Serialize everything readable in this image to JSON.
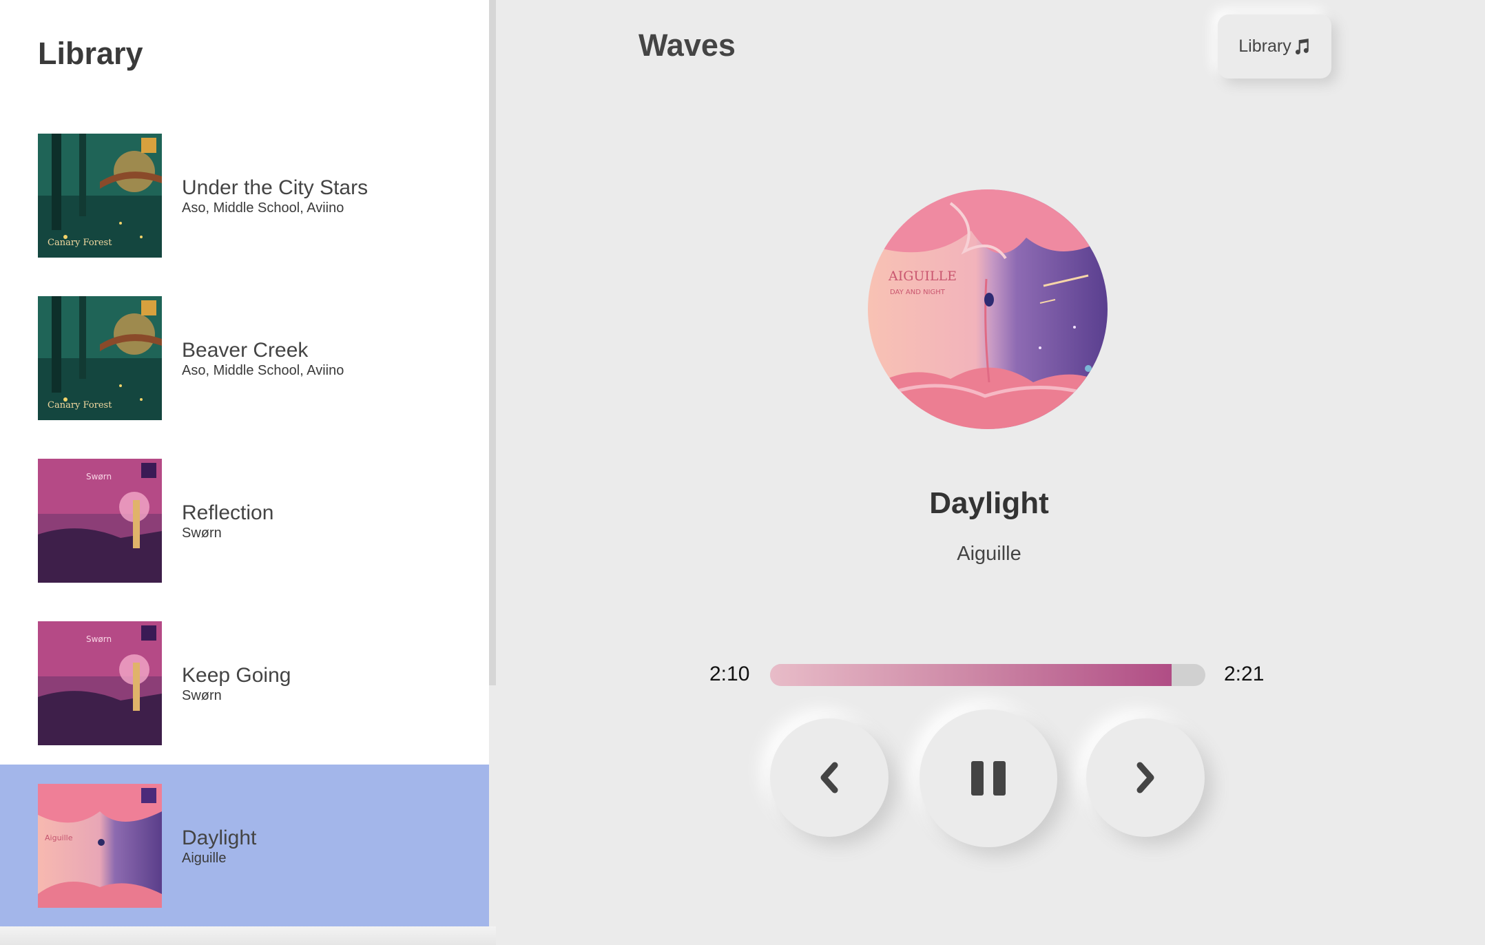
{
  "library": {
    "title": "Library",
    "tracks": [
      {
        "name": "Under the City Stars",
        "artist": "Aso, Middle School, Aviino",
        "cover": "canary-forest",
        "cover_text": "Canary Forest",
        "selected": false
      },
      {
        "name": "Beaver Creek",
        "artist": "Aso, Middle School, Aviino",
        "cover": "canary-forest",
        "cover_text": "Canary Forest",
        "selected": false
      },
      {
        "name": "Reflection",
        "artist": "Swørn",
        "cover": "sworn",
        "cover_text": "Swørn",
        "selected": false
      },
      {
        "name": "Keep Going",
        "artist": "Swørn",
        "cover": "sworn",
        "cover_text": "Swørn",
        "selected": false
      },
      {
        "name": "Daylight",
        "artist": "Aiguille",
        "cover": "aiguille",
        "cover_text": "Aiguille",
        "selected": true
      }
    ]
  },
  "player": {
    "brand": "Waves",
    "library_button_label": "Library",
    "library_button_icon": "music-note-icon",
    "now_playing": {
      "title": "Daylight",
      "artist": "Aiguille",
      "cover": "aiguille",
      "cover_text": "AIGUILLE",
      "cover_subtext": "DAY AND NIGHT"
    },
    "current_time": "2:10",
    "total_time": "2:21",
    "progress_fraction": 0.922,
    "controls": {
      "prev_icon": "chevron-left-icon",
      "play_icon": "pause-icon",
      "next_icon": "chevron-right-icon"
    }
  },
  "colors": {
    "selected_row": "#a3b6ea",
    "progress_start": "#e8bcc8",
    "progress_end": "#b04d85",
    "background": "#ebebeb"
  }
}
